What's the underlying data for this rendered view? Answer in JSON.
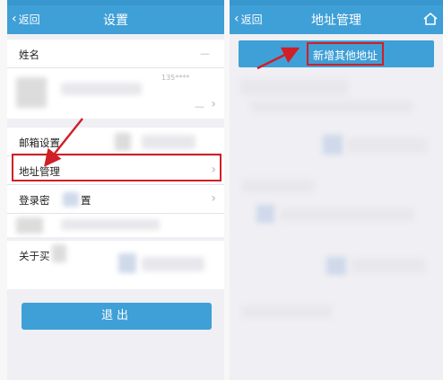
{
  "left_screen": {
    "nav": {
      "back_label": "返回",
      "title": "设置"
    },
    "profile": {
      "name_label": "姓名",
      "name_value_placeholder": "—",
      "phone_masked": "135****",
      "row2_dash": "—"
    },
    "menu": [
      {
        "label": "邮箱设置",
        "has_arrow": false
      },
      {
        "label": "地址管理",
        "has_arrow": true
      },
      {
        "label": "登录密码设置",
        "visible_label": "登录密",
        "visible_suffix": "置",
        "has_arrow": true
      },
      {
        "label_prefix": "关于买",
        "has_arrow": false
      }
    ],
    "logout_label": "退出"
  },
  "right_screen": {
    "nav": {
      "back_label": "返回",
      "title": "地址管理"
    },
    "add_address_label": "新增其他地址"
  },
  "annotation": {
    "color": "#d01f26"
  },
  "colors": {
    "nav_bg": "#3f9fd7",
    "page_bg": "#efeff4"
  }
}
